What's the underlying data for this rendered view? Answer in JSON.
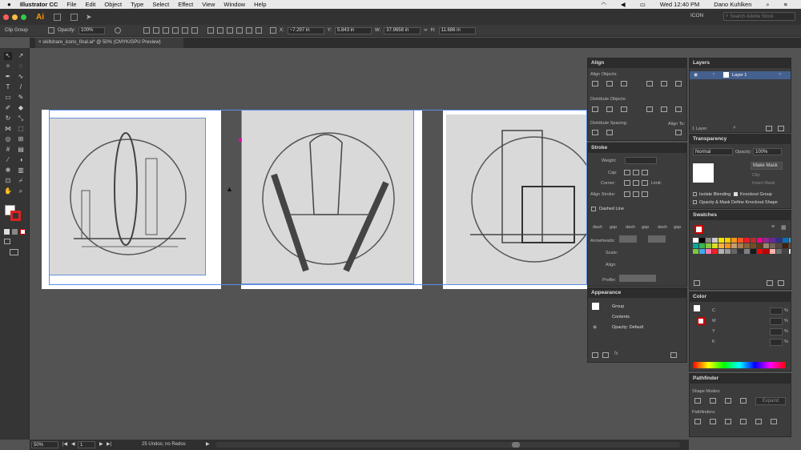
{
  "menubar": {
    "app": "Illustrator CC",
    "items": [
      "File",
      "Edit",
      "Object",
      "Type",
      "Select",
      "Effect",
      "View",
      "Window",
      "Help"
    ],
    "clock": "Wed 12:40 PM",
    "user": "Dano Kuhlken"
  },
  "appbar": {
    "workspace": "ICON",
    "search_placeholder": "Search Adobe Stock"
  },
  "control": {
    "selection": "Clip Group",
    "opacity_label": "Opacity:",
    "opacity": "100%",
    "x_label": "X:",
    "x": "~7.297 in",
    "y_label": "Y:",
    "y": "5.843 in",
    "w_label": "W:",
    "w": "37.9658 in",
    "h_label": "H:",
    "h": "11.686 in"
  },
  "doc_tab": "skillshare_icons_final.ai* @ 50% (CMYK/GPU Preview)",
  "align": {
    "title": "Align",
    "align_objects": "Align Objects:",
    "distribute_objects": "Distribute Objects:",
    "distribute_spacing": "Distribute Spacing:",
    "align_to": "Align To:"
  },
  "stroke": {
    "title": "Stroke",
    "weight": "Weight:",
    "cap": "Cap:",
    "corner": "Corner:",
    "limit": "Limit:",
    "align_stroke": "Align Stroke:",
    "dashed_line": "Dashed Line",
    "dash_labels": [
      "dash",
      "gap",
      "dash",
      "gap",
      "dash",
      "gap"
    ],
    "arrowheads": "Arrowheads:",
    "scale": "Scale:",
    "align": "Align:",
    "profile": "Profile:"
  },
  "appearance": {
    "title": "Appearance",
    "group": "Group",
    "contents": "Contents",
    "opacity": "Opacity: Default"
  },
  "layers": {
    "title": "Layers",
    "layer1": "Layer 1",
    "count": "1 Layer"
  },
  "transparency": {
    "title": "Transparency",
    "mode": "Normal",
    "opacity_label": "Opacity:",
    "opacity": "100%",
    "make_mask": "Make Mask",
    "clip": "Clip",
    "invert": "Invert Mask",
    "isolate": "Isolate Blending",
    "knockout": "Knockout Group",
    "define": "Opacity & Mask Define Knockout Shape"
  },
  "swatches": {
    "title": "Swatches",
    "colors": [
      "#fff",
      "#000",
      "#888",
      "#ccc",
      "#f2e400",
      "#ffcc00",
      "#f7941d",
      "#f15a24",
      "#ed1c24",
      "#c1272d",
      "#ec008c",
      "#92278f",
      "#662d91",
      "#2e3192",
      "#0071bc",
      "#29abe2",
      "#00a99d",
      "#39b54a",
      "#8cc63f",
      "#d9e021",
      "#fbb03b",
      "#f7931e",
      "#c69c6d",
      "#a67c52",
      "#8c6239",
      "#754c24",
      "#603813",
      "#998675",
      "#736357",
      "#534741",
      "#42210b",
      "#6c4e3a",
      "#7ac943",
      "#3fa9f5",
      "#ff7bac",
      "#ff1d25",
      "#b3b3b3",
      "#999",
      "#666",
      "#333",
      "#808080",
      "#1a1a1a",
      "#ff0000",
      "#c00000",
      "#ffb3b3",
      "#6e6e6e",
      "#444",
      "#e6e6e6"
    ]
  },
  "color": {
    "title": "Color",
    "channels": [
      "C",
      "M",
      "Y",
      "K"
    ],
    "unit": "%"
  },
  "pathfinder": {
    "title": "Pathfinder",
    "shape_modes": "Shape Modes:",
    "pathfinders": "Pathfinders:",
    "expand": "Expand"
  },
  "status": {
    "zoom": "50%",
    "page": "1",
    "undos": "25 Undos; no Redos"
  }
}
